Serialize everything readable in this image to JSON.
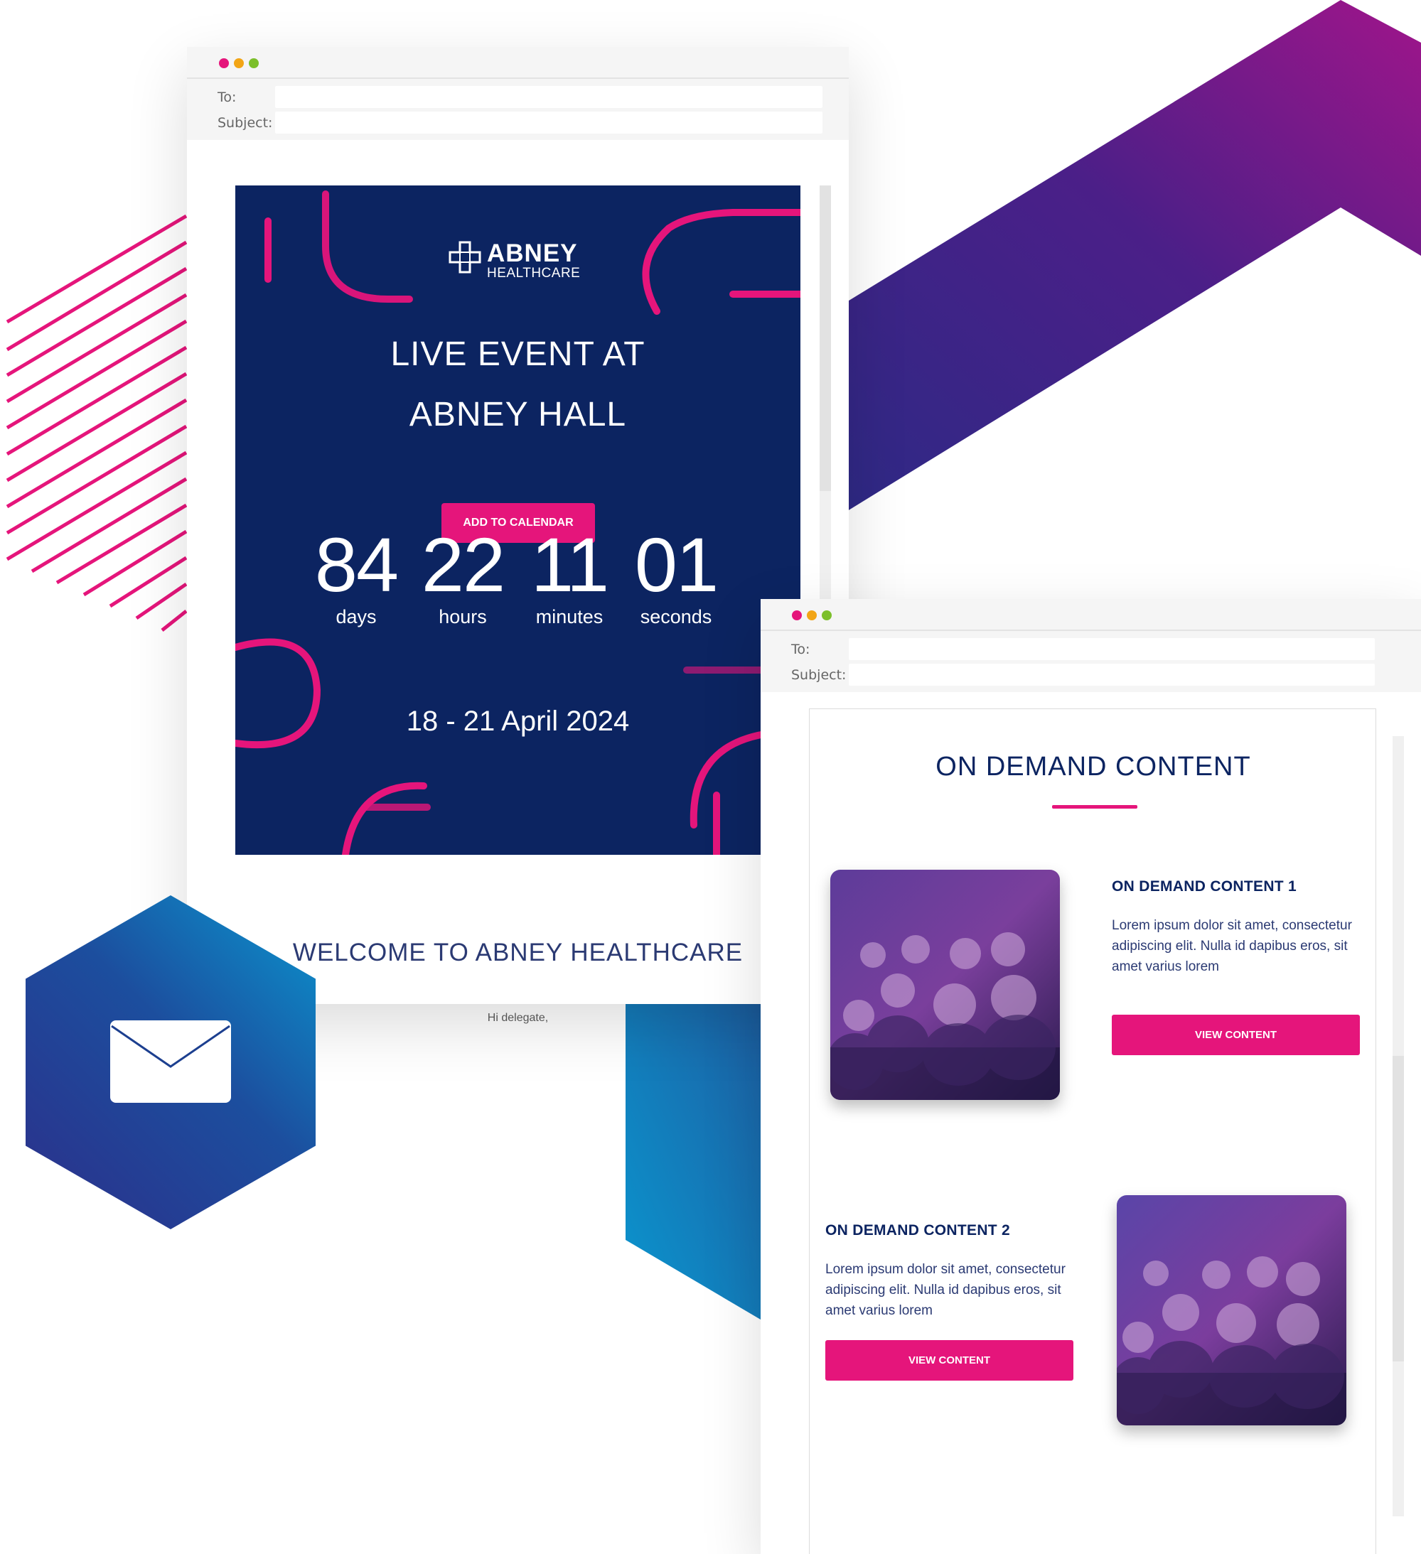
{
  "colors": {
    "navy": "#0c2461",
    "magenta": "#e5157b",
    "purple": "#7a1a8a",
    "blue": "#0a96cf"
  },
  "email_window_1": {
    "fields": {
      "to_label": "To:",
      "subject_label": "Subject:",
      "to_value": "",
      "subject_value": ""
    },
    "hero": {
      "brand_name": "ABNEY",
      "brand_sub": "HEALTHCARE",
      "title_line_1": "LIVE EVENT AT",
      "title_line_2": "ABNEY HALL",
      "cta_label": "ADD TO CALENDAR",
      "countdown": [
        {
          "value": "84",
          "unit": "days"
        },
        {
          "value": "22",
          "unit": "hours"
        },
        {
          "value": "11",
          "unit": "minutes"
        },
        {
          "value": "01",
          "unit": "seconds"
        }
      ],
      "event_dates": "18 - 21 April 2024"
    },
    "welcome_heading": "WELCOME TO ABNEY HEALTHCARE",
    "greeting": "Hi delegate,"
  },
  "email_window_2": {
    "fields": {
      "to_label": "To:",
      "subject_label": "Subject:",
      "to_value": "",
      "subject_value": ""
    },
    "section_title": "ON DEMAND CONTENT",
    "items": [
      {
        "heading": "ON DEMAND CONTENT 1",
        "body": "Lorem ipsum dolor sit amet, consectetur adipiscing elit. Nulla id dapibus eros, sit amet varius lorem",
        "button_label": "VIEW CONTENT"
      },
      {
        "heading": "ON DEMAND CONTENT 2",
        "body": "Lorem ipsum dolor sit amet, consectetur adipiscing elit. Nulla id dapibus eros, sit amet varius lorem",
        "button_label": "VIEW CONTENT"
      }
    ]
  },
  "icons": {
    "app_badge": "envelope-icon",
    "logo": "medical-cross-icon",
    "window_controls": [
      "close-dot",
      "minimize-dot",
      "maximize-dot"
    ]
  }
}
